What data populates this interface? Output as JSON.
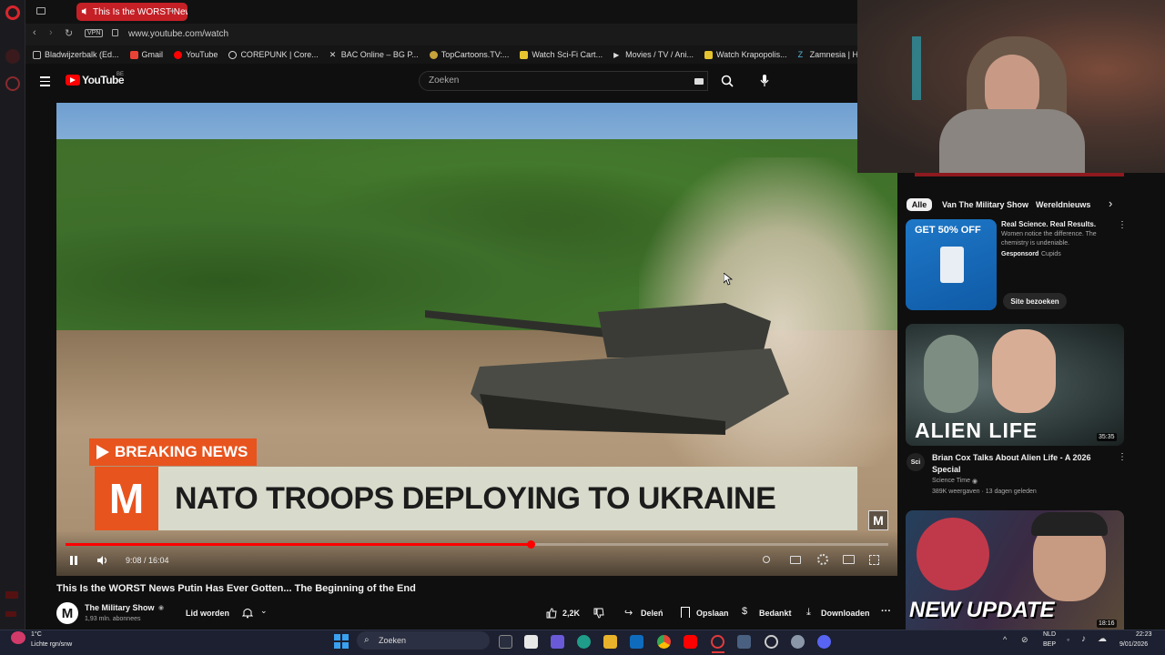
{
  "browser": {
    "tab_title": "This Is the WORST New",
    "tab_add": "+",
    "url": "www.youtube.com/watch",
    "vpn": "VPN",
    "bookmarks": [
      "Bladwijzerbalk (Ed...",
      "Gmail",
      "YouTube",
      "COREPUNK | Core...",
      "BAC Online – BG P...",
      "TopCartoons.TV:...",
      "Watch Sci-Fi Cart...",
      "Movies / TV / Ani...",
      "Watch Krapopolis...",
      "Zamnesia | Het Be"
    ]
  },
  "youtube": {
    "logo": "YouTube",
    "country": "BE",
    "search_placeholder": "Zoeken"
  },
  "video": {
    "breaking": "BREAKING NEWS",
    "channel_letter": "M",
    "headline": "NATO TROOPS DEPLOYING TO UKRAINE",
    "watermark": "M",
    "time": "9:08 / 16:04",
    "progress": 0.565
  },
  "watch": {
    "title": "This Is the WORST News Putin Has Ever Gotten... The Beginning of the End",
    "channel": "The Military Show",
    "subscribers": "1,93 mln. abonnees",
    "join": "Lid worden",
    "likes": "2,2K",
    "share": "Deleń",
    "save": "Opslaan",
    "thanks": "Bedankt",
    "download": "Downloaden",
    "more": "···"
  },
  "sidebar": {
    "chips": [
      "Alle",
      "Van The Military Show",
      "Wereldnieuws"
    ],
    "ad": {
      "image_text": "GET 50% OFF",
      "title": "Real Science. Real Results.",
      "desc": "Women notice the difference. The chemistry is undeniable.",
      "sponsored": "Gesponsord",
      "advertiser": "Cupids",
      "cta": "Site bezoeken"
    },
    "videos": [
      {
        "thumb_text": "ALIEN LIFE",
        "duration": "35:35",
        "title": "Brian Cox Talks About Alien Life - A 2026 Special",
        "channel": "Science Time",
        "meta": "389K weergaven · 13 dagen geleden",
        "avatar": "Sci"
      },
      {
        "thumb_text": "NEW UPDATE",
        "duration": "18:16"
      }
    ]
  },
  "taskbar": {
    "weather_temp": "1°C",
    "weather_desc": "Lichte rgn/snw",
    "search": "Zoeken",
    "lang1": "NLD",
    "lang2": "BEP",
    "time": "22:23",
    "date": "9/01/2026"
  },
  "colors": {
    "youtube_red": "#ff0000",
    "opera_red": "#c42026",
    "breaking_orange": "#e8541e"
  }
}
